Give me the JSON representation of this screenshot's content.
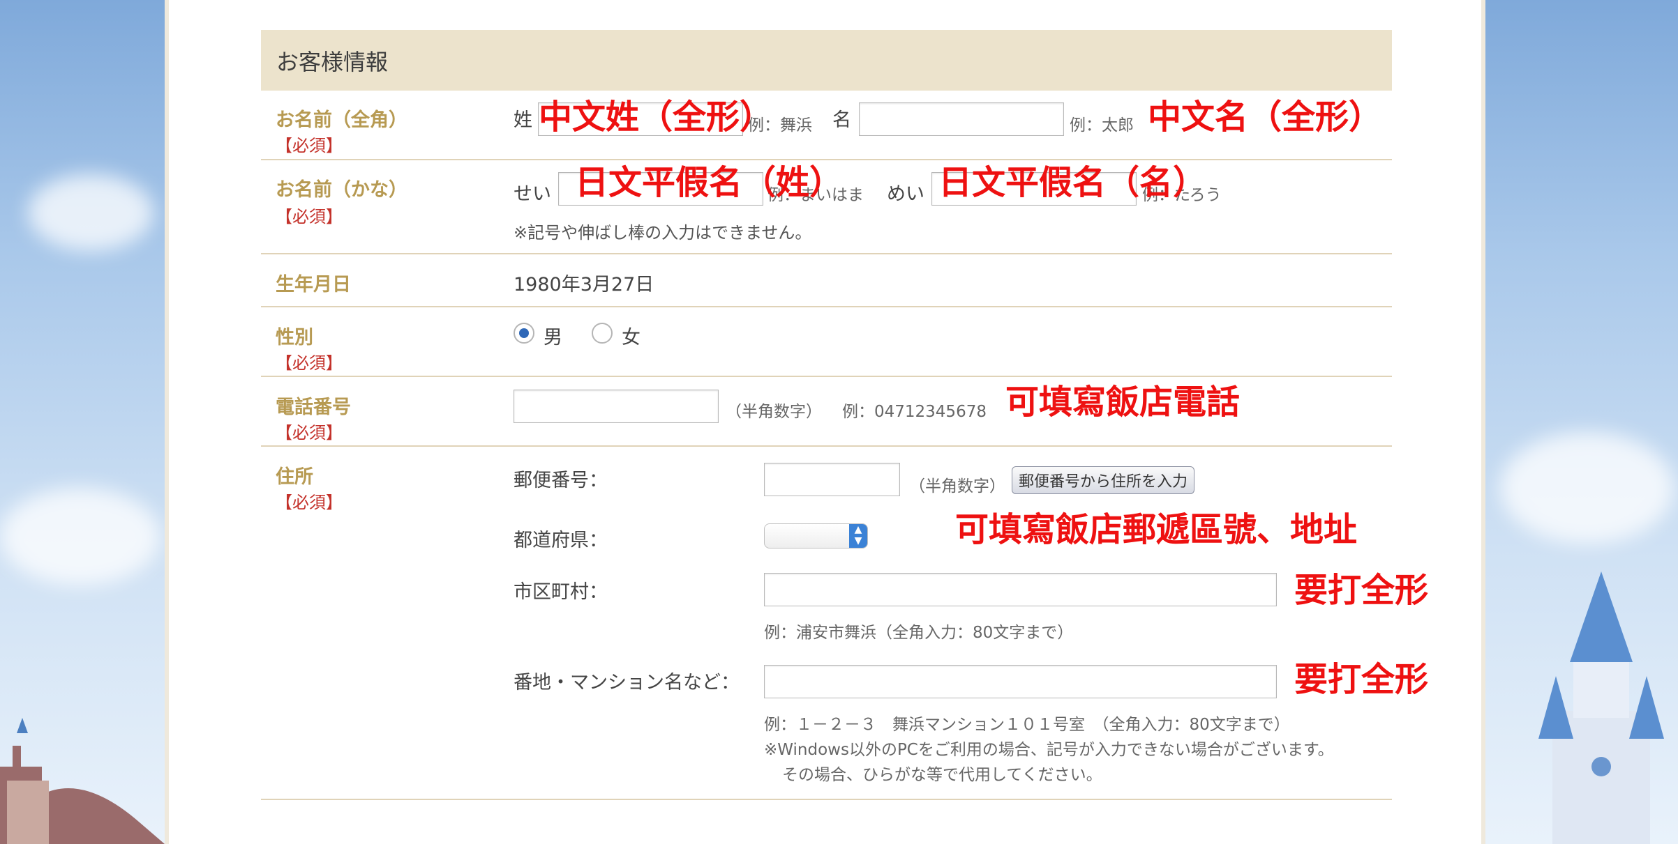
{
  "form": {
    "section_title": "お客様情報",
    "required_label": "【必須】",
    "name": {
      "label": "お名前（全角）",
      "sei_label": "姓",
      "sei_example": "例：舞浜",
      "mei_label": "名",
      "mei_example": "例：太郎"
    },
    "kana": {
      "label": "お名前（かな）",
      "sei_label": "せい",
      "sei_example": "例：まいはま",
      "mei_label": "めい",
      "mei_example": "例：たろう",
      "note": "※記号や伸ばし棒の入力はできません。"
    },
    "birthday": {
      "label": "生年月日",
      "value": "1980年3月27日"
    },
    "gender": {
      "label": "性別",
      "male": "男",
      "female": "女",
      "selected": "男"
    },
    "phone": {
      "label": "電話番号",
      "hint": "（半角数字）",
      "example": "例：04712345678"
    },
    "address": {
      "label": "住所",
      "postal_label": "郵便番号：",
      "postal_hint": "（半角数字）",
      "postal_button": "郵便番号から住所を入力",
      "prefecture_label": "都道府県：",
      "prefecture_value": "",
      "city_label": "市区町村：",
      "city_example": "例：浦安市舞浜（全角入力：80文字まで）",
      "street_label": "番地・マンション名など：",
      "street_example": "例：１－２－３　舞浜マンション１０１号室　（全角入力：80文字まで）",
      "note_line1": "※Windows以外のPCをご利用の場合、記号が入力できない場合がございます。",
      "note_line2": "その場合、ひらがな等で代用してください。"
    }
  },
  "annotations": {
    "name_sei": "中文姓（全形）",
    "name_mei": "中文名（全形）",
    "kana_sei": "日文平假名（姓）",
    "kana_mei": "日文平假名（名）",
    "phone": "可填寫飯店電話",
    "address": "可填寫飯店郵遞區號、地址",
    "city": "要打全形",
    "street": "要打全形"
  },
  "colors": {
    "label": "#b79a52",
    "required": "#c4322b",
    "annotation": "#ee1111",
    "header_bg": "#ece3cc",
    "radio_selected": "#2f68b8"
  }
}
